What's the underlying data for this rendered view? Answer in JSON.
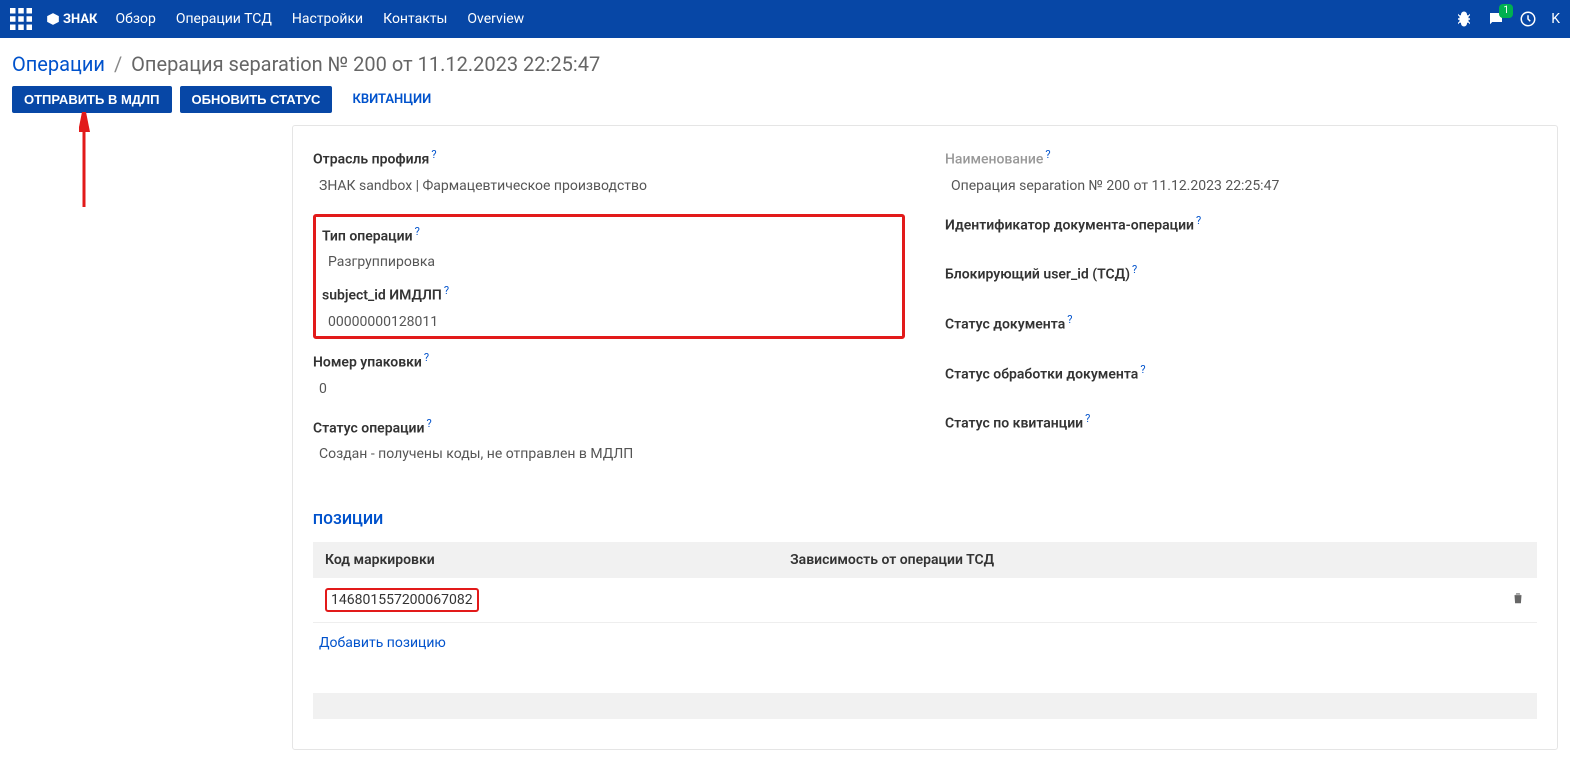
{
  "header": {
    "logo_text": "ЗНАК",
    "nav": [
      "Обзор",
      "Операции ТСД",
      "Настройки",
      "Контакты",
      "Overview"
    ],
    "chat_badge": "1",
    "user_letter": "K"
  },
  "breadcrumb": {
    "root": "Операции",
    "sep": "/",
    "current": "Операция separation № 200 от 11.12.2023 22:25:47"
  },
  "actions": {
    "send_mdlp": "ОТПРАВИТЬ В МДЛП",
    "update_status": "ОБНОВИТЬ СТАТУС",
    "receipts": "КВИТАНЦИИ"
  },
  "fields": {
    "left": {
      "profile_industry_label": "Отрасль профиля",
      "profile_industry_value": "ЗНАК sandbox | Фармацевтическое производство",
      "op_type_label": "Тип операции",
      "op_type_value": "Разгруппировка",
      "subject_id_label": "subject_id ИМДЛП",
      "subject_id_value": "00000000128011",
      "package_num_label": "Номер упаковки",
      "package_num_value": "0",
      "op_status_label": "Статус операции",
      "op_status_value": "Создан - получены коды, не отправлен в МДЛП"
    },
    "right": {
      "name_label": "Наименование",
      "name_value": "Операция separation № 200 от 11.12.2023 22:25:47",
      "doc_id_label": "Идентификатор документа-операции",
      "blocking_user_label": "Блокирующий user_id (ТСД)",
      "doc_status_label": "Статус документа",
      "doc_processing_label": "Статус обработки документа",
      "receipt_status_label": "Статус по квитанции"
    }
  },
  "positions": {
    "section_title": "ПОЗИЦИИ",
    "col_code": "Код маркировки",
    "col_dependency": "Зависимость от операции ТСД",
    "rows": [
      {
        "code": "146801557200067082",
        "dependency": ""
      }
    ],
    "add_label": "Добавить позицию"
  },
  "help_q": "?"
}
